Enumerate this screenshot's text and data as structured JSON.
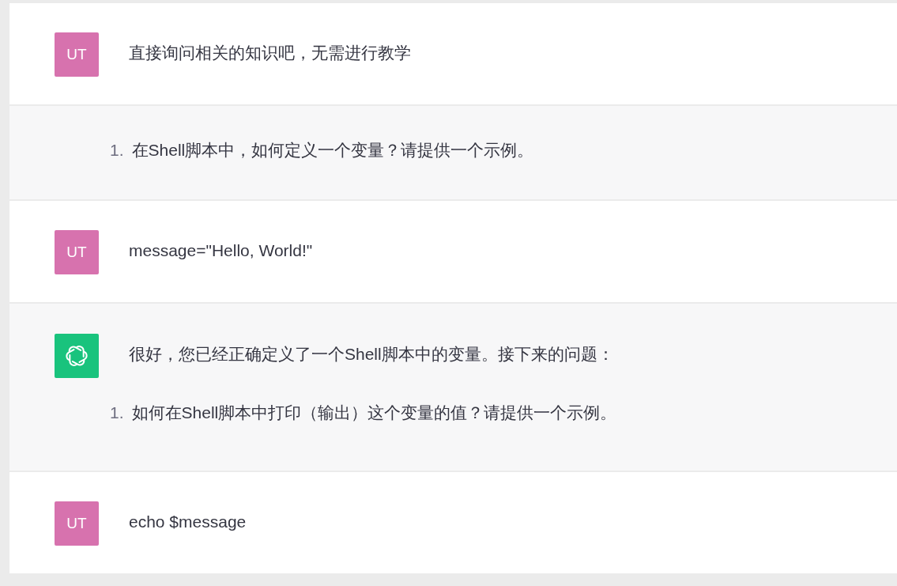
{
  "messages": [
    {
      "kind": "user",
      "avatar": {
        "kind": "initials",
        "text": "UT"
      },
      "paragraphs": [
        "直接询问相关的知识吧，无需进行教学"
      ]
    },
    {
      "kind": "assistant",
      "list": [
        {
          "number": "1.",
          "text": "在Shell脚本中，如何定义一个变量？请提供一个示例。"
        }
      ]
    },
    {
      "kind": "user",
      "avatar": {
        "kind": "initials",
        "text": "UT"
      },
      "paragraphs": [
        "message=\"Hello, World!\""
      ]
    },
    {
      "kind": "assistant",
      "avatar": {
        "kind": "logo"
      },
      "paragraphs": [
        "很好，您已经正确定义了一个Shell脚本中的变量。接下来的问题："
      ],
      "list": [
        {
          "number": "1.",
          "text": "如何在Shell脚本中打印（输出）这个变量的值？请提供一个示例。"
        }
      ]
    },
    {
      "kind": "user",
      "avatar": {
        "kind": "initials",
        "text": "UT"
      },
      "paragraphs": [
        "echo $message"
      ]
    }
  ]
}
